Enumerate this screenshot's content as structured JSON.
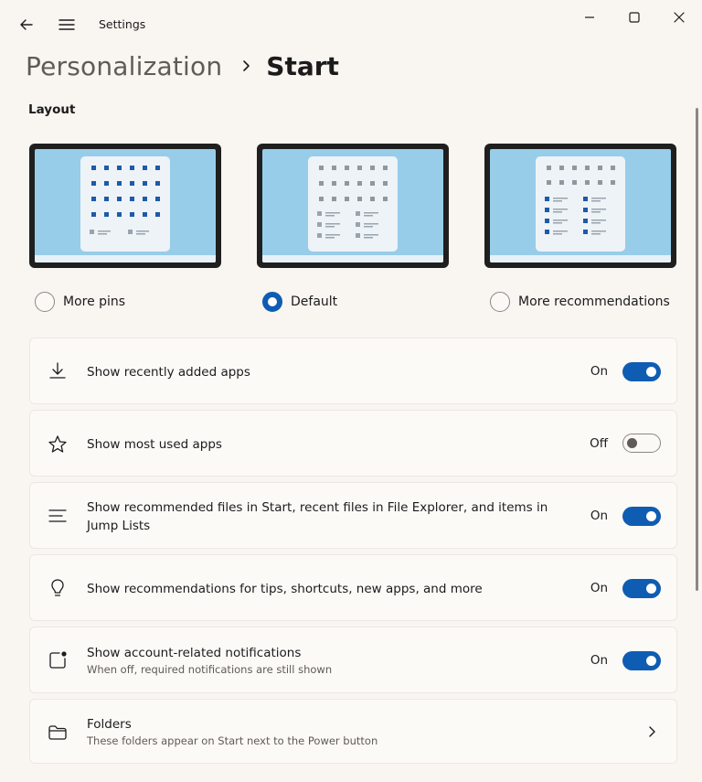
{
  "window": {
    "title": "Settings"
  },
  "breadcrumb": {
    "parent": "Personalization",
    "current": "Start"
  },
  "layout_section": {
    "label": "Layout",
    "options": [
      {
        "label": "More pins",
        "selected": false
      },
      {
        "label": "Default",
        "selected": true
      },
      {
        "label": "More recommendations",
        "selected": false
      }
    ]
  },
  "settings": [
    {
      "icon": "download-icon",
      "title": "Show recently added apps",
      "subtitle": "",
      "state": "On",
      "control": "toggle-on"
    },
    {
      "icon": "star-icon",
      "title": "Show most used apps",
      "subtitle": "",
      "state": "Off",
      "control": "toggle-off"
    },
    {
      "icon": "list-icon",
      "title": "Show recommended files in Start, recent files in File Explorer, and items in",
      "title_line2": "Jump Lists",
      "subtitle": "",
      "state": "On",
      "control": "toggle-on"
    },
    {
      "icon": "lightbulb-icon",
      "title": "Show recommendations for tips, shortcuts, new apps, and more",
      "subtitle": "",
      "state": "On",
      "control": "toggle-on"
    },
    {
      "icon": "notification-icon",
      "title": "Show account-related notifications",
      "subtitle": "When off, required notifications are still shown",
      "state": "On",
      "control": "toggle-on"
    },
    {
      "icon": "folder-icon",
      "title": "Folders",
      "subtitle": "These folders appear on Start next to the Power button",
      "state": "",
      "control": "chevron"
    }
  ],
  "colors": {
    "background": "#f9f5f1",
    "accent": "#0f5cb3",
    "card": "#fcfaf7",
    "screen": "#97cde9"
  }
}
